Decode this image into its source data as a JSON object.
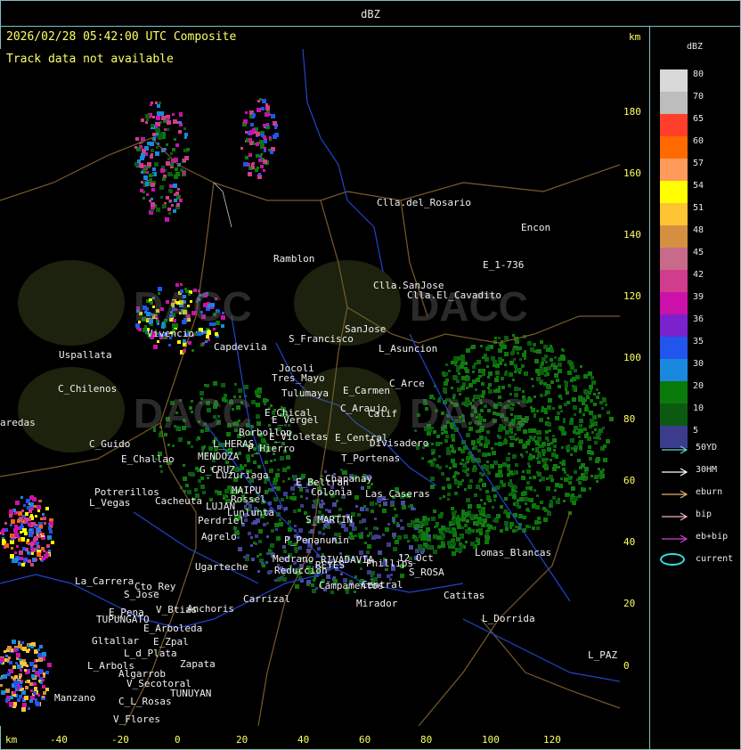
{
  "window": {
    "title": "dBZ"
  },
  "header": {
    "timestamp": "2026/02/28 05:42:00 UTC Composite",
    "unit_top": "km",
    "notice": "Track data not available"
  },
  "axes": {
    "y_ticks": [
      "180",
      "160",
      "140",
      "120",
      "100",
      "80",
      "60",
      "40",
      "20",
      "0"
    ],
    "x_ticks": [
      "-40",
      "-20",
      "0",
      "20",
      "40",
      "60",
      "80",
      "100",
      "120"
    ],
    "x_unit": "km"
  },
  "watermark": {
    "text": "DACC"
  },
  "places": [
    "Clla.del_Rosario",
    "Encon",
    "Ramblon",
    "E_1-736",
    "Clla.SanJose",
    "Clla.El_Cavadito",
    "Uspallata",
    "Vivencio",
    "Capdevila",
    "S_Francisco",
    "SanJose",
    "L_Asuncion",
    "C_Chilenos",
    "Tres_Mayo",
    "Jocoli",
    "Tulumaya",
    "E_Carmen",
    "C_Arce",
    "aredas",
    "E_Chical",
    "E_Vergel",
    "C_Araujo",
    "Calif",
    "Borbollon",
    "E_Violetas",
    "E_Central",
    "Divisadero",
    "C_Guido",
    "E_Challao",
    "L_HERAS",
    "P_Hierro",
    "T_Portenas",
    "MENDOZA",
    "G_CRUZ",
    "Luzuriaga",
    "Chapanay",
    "E_Beltran",
    "Colonia",
    "Las_Caseras",
    "Potrerillos",
    "MAIPU",
    "Rossel",
    "L_Vegas",
    "Cacheuta",
    "LUJAN",
    "Lunlunta",
    "Perdriel",
    "S_MARTIN",
    "Agrelo",
    "P_Penanunin",
    "Medrano",
    "REYES",
    "Ugarteche",
    "Reduccion",
    "RIVADAVIA",
    "Phillips",
    "12_Oct",
    "S_ROSA",
    "Lomas_Blancas",
    "La_Carrera",
    "Cto_Rey",
    "S_Jose",
    "Carrizal",
    "Campamentos",
    "Central",
    "Catitas",
    "E_Pena",
    "TUPUNGATO",
    "V_Btias",
    "Anchoris",
    "Mirador",
    "L_Dorrida",
    "E_Arboleda",
    "Gltallar",
    "E_Zpal",
    "L_d_Plata",
    "Zapata",
    "L_Arbols",
    "Algarrob",
    "V_Secotoral",
    "TUNUYAN",
    "Manzano",
    "C_L_Rosas",
    "V_Flores",
    "L_PAZ"
  ],
  "legend": {
    "title": "dBZ",
    "levels": [
      {
        "label": "80",
        "color": "#d8d8d8"
      },
      {
        "label": "70",
        "color": "#bdbdbd"
      },
      {
        "label": "65",
        "color": "#ff3f2a"
      },
      {
        "label": "60",
        "color": "#ff6a00"
      },
      {
        "label": "57",
        "color": "#ff9a5a"
      },
      {
        "label": "54",
        "color": "#ffff00"
      },
      {
        "label": "51",
        "color": "#ffc433"
      },
      {
        "label": "48",
        "color": "#d49040"
      },
      {
        "label": "45",
        "color": "#c86a8a"
      },
      {
        "label": "42",
        "color": "#d23c8c"
      },
      {
        "label": "39",
        "color": "#cc11aa"
      },
      {
        "label": "36",
        "color": "#7a22cc"
      },
      {
        "label": "35",
        "color": "#2255ee"
      },
      {
        "label": "30",
        "color": "#1a88dd"
      },
      {
        "label": "20",
        "color": "#0a7a0a"
      },
      {
        "label": "10",
        "color": "#0c5a12"
      },
      {
        "label": "5",
        "color": "#3b3c8c"
      }
    ],
    "tracks": [
      {
        "label": "50YD",
        "color": "#5fd6d6"
      },
      {
        "label": "30HM",
        "color": "#ffffff"
      },
      {
        "label": "eburn",
        "color": "#e8b070"
      },
      {
        "label": "bip",
        "color": "#f0b0d0"
      },
      {
        "label": "eb+bip",
        "color": "#d040d0"
      },
      {
        "label": "current",
        "color": "#33dddd"
      }
    ]
  }
}
